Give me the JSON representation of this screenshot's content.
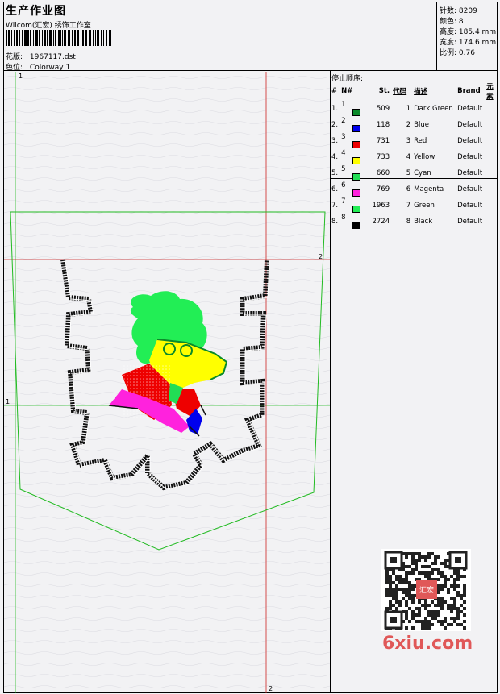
{
  "header": {
    "title": "生产作业图",
    "company": "Wilcom(汇宏) 绣饰工作室",
    "design_label": "花版:",
    "design_value": "1967117.dst",
    "colorway_label": "色位:",
    "colorway_value": "Colorway 1"
  },
  "stats": [
    {
      "label": "针数:",
      "value": "8209"
    },
    {
      "label": "颜色:",
      "value": "8"
    },
    {
      "label": "高度:",
      "value": "185.4 mm"
    },
    {
      "label": "宽度:",
      "value": "174.6 mm"
    },
    {
      "label": "比例:",
      "value": "0.76"
    }
  ],
  "stop_sequence": {
    "title": "停止顺序:",
    "columns": [
      "#",
      "N#",
      "St.",
      "代码",
      "描述",
      "Brand",
      "元素"
    ],
    "rows": [
      {
        "n": "1.",
        "num": "1",
        "color": "#0a8a2a",
        "st": "509",
        "code": "1",
        "desc": "Dark Green",
        "brand": "Default"
      },
      {
        "n": "2.",
        "num": "2",
        "color": "#0000ee",
        "st": "118",
        "code": "2",
        "desc": "Blue",
        "brand": "Default"
      },
      {
        "n": "3.",
        "num": "3",
        "color": "#ee0000",
        "st": "731",
        "code": "3",
        "desc": "Red",
        "brand": "Default"
      },
      {
        "n": "4.",
        "num": "4",
        "color": "#ffff00",
        "st": "733",
        "code": "4",
        "desc": "Yellow",
        "brand": "Default"
      },
      {
        "n": "5.",
        "num": "5",
        "color": "#22dd55",
        "st": "660",
        "code": "5",
        "desc": "Cyan",
        "brand": "Default"
      },
      {
        "n": "6.",
        "num": "6",
        "color": "#ff22dd",
        "st": "769",
        "code": "6",
        "desc": "Magenta",
        "brand": "Default"
      },
      {
        "n": "7.",
        "num": "7",
        "color": "#22ee55",
        "st": "1963",
        "code": "7",
        "desc": "Green",
        "brand": "Default"
      },
      {
        "n": "8.",
        "num": "8",
        "color": "#000000",
        "st": "2724",
        "code": "8",
        "desc": "Black",
        "brand": "Default"
      }
    ]
  },
  "canvas": {
    "tick_1": "1",
    "tick_2": "2",
    "line_green": "#22bb22",
    "line_red": "#cc2222"
  },
  "watermark": {
    "site": "6xiu.com",
    "stamp": "汇宏"
  }
}
